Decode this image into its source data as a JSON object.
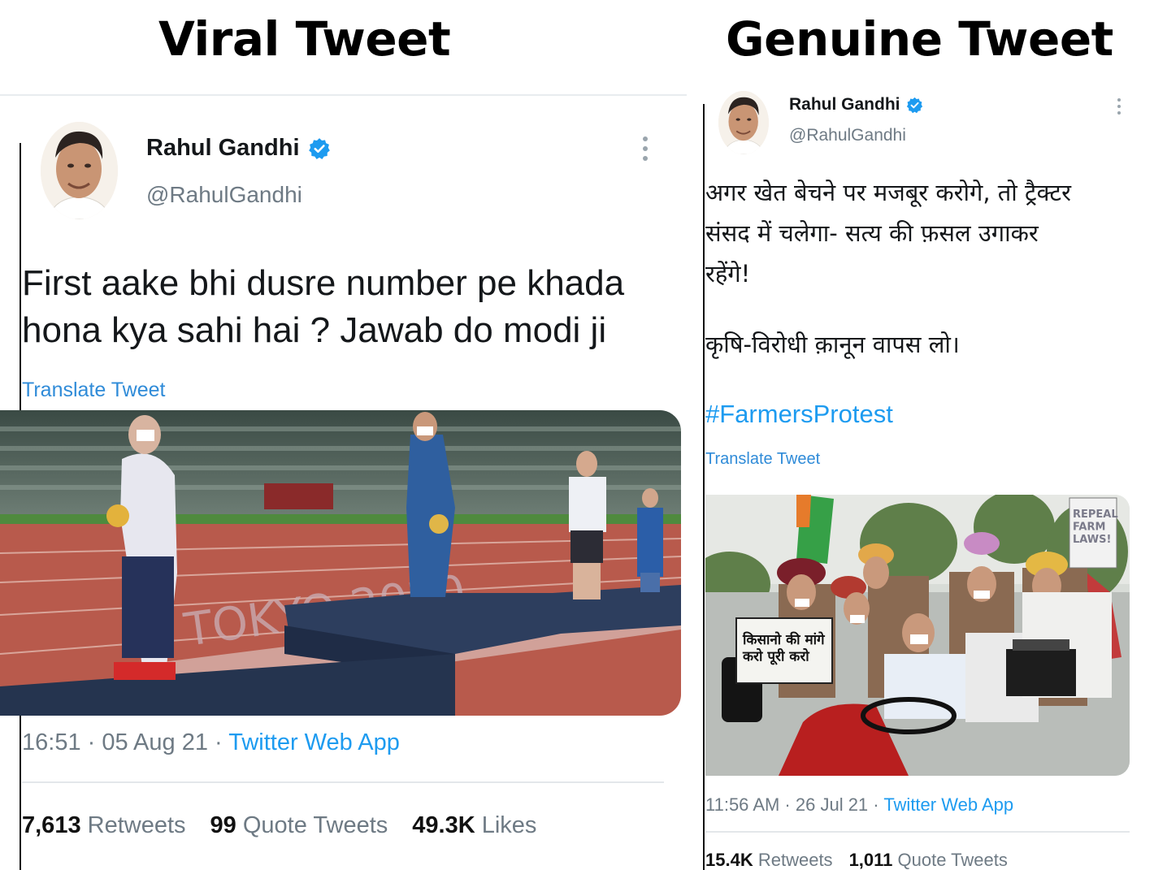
{
  "headings": {
    "left": "Viral Tweet",
    "right": "Genuine Tweet"
  },
  "viral": {
    "name": "Rahul Gandhi",
    "handle": "@RahulGandhi",
    "text": "First aake bhi dusre number pe khada\nhona kya sahi hai ? Jawab do modi ji",
    "translate": "Translate Tweet",
    "photo": {
      "signage": "TOKYO 2020"
    },
    "time": "16:51 · 05 Aug 21 · ",
    "app": "Twitter Web App",
    "stats": [
      {
        "count": "7,613",
        "label": "Retweets"
      },
      {
        "count": "99",
        "label": "Quote Tweets"
      },
      {
        "count": "49.3K",
        "label": "Likes"
      }
    ]
  },
  "genuine": {
    "name": "Rahul Gandhi",
    "handle": "@RahulGandhi",
    "text": "अगर खेत बेचने पर मजबूर करोगे, तो ट्रैक्टर\nसंसद में चलेगा- सत्य की फ़सल उगाकर\nरहेंगे!",
    "text2": "कृषि-विरोधी क़ानून वापस लो।",
    "hashtag": "#FarmersProtest",
    "translate": "Translate Tweet",
    "photo": {
      "placard1": "किसानो की मांगे\nकरो पूरी करो",
      "placard2": "REPEAL\nFARM\nLAWS!"
    },
    "time": "11:56 AM · 26 Jul 21 · ",
    "app": "Twitter Web App",
    "stats": [
      {
        "count": "15.4K",
        "label": "Retweets"
      },
      {
        "count": "1,011",
        "label": "Quote Tweets"
      }
    ]
  },
  "colors": {
    "verified": "#1d9bf0",
    "link": "#1d9bf0",
    "muted": "#6e7a84"
  },
  "icons": [
    "verified-badge-icon",
    "more-options-icon"
  ]
}
